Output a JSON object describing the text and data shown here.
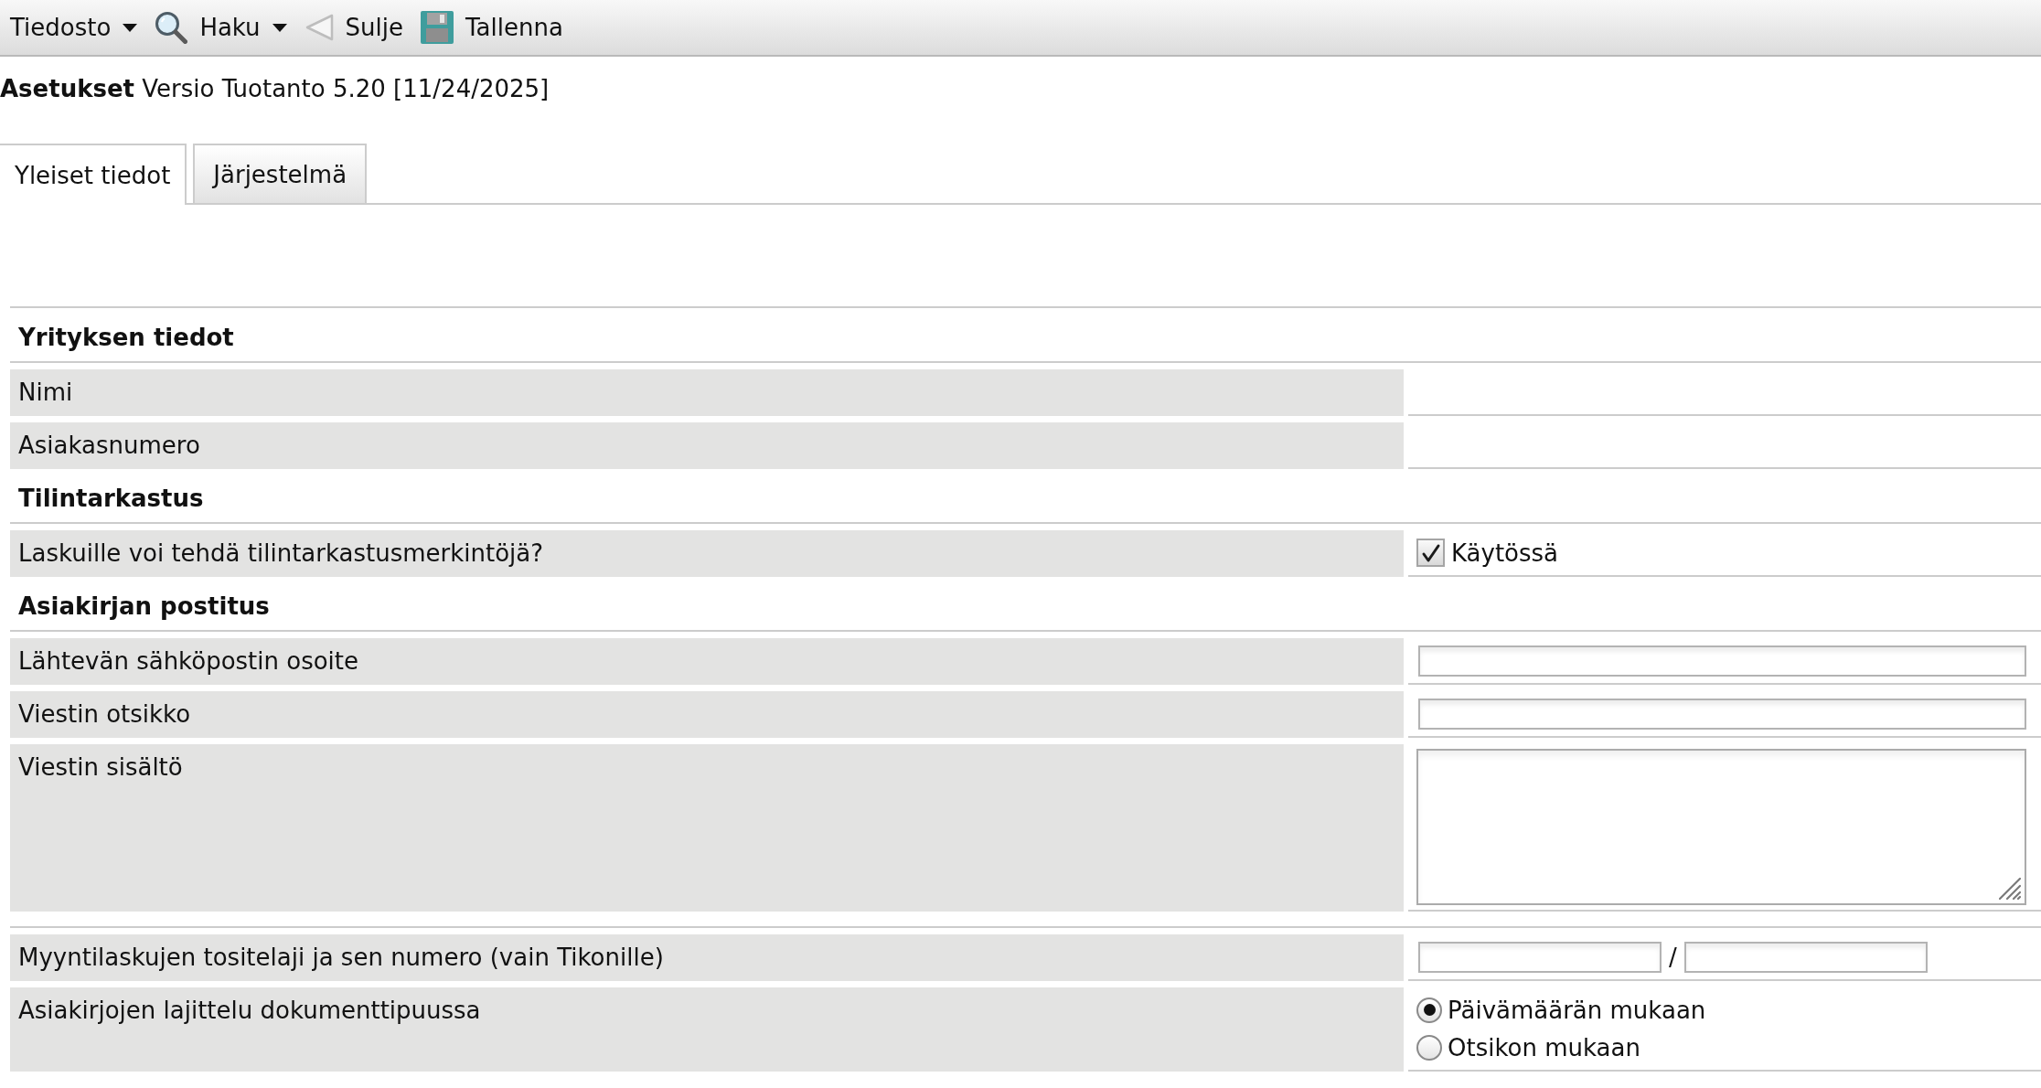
{
  "toolbar": {
    "items": [
      {
        "label": "Tiedosto",
        "kind": "menu"
      },
      {
        "label": "Haku",
        "kind": "menu"
      },
      {
        "label": "Sulje",
        "kind": "button"
      },
      {
        "label": "Tallenna",
        "kind": "button"
      }
    ]
  },
  "page_title": "**Asetukset** Versio Tuotanto 5.20 [11/24/2025]",
  "tabs": [
    {
      "label": "Yleiset tiedot",
      "selected": true
    },
    {
      "label": "Järjestelmä",
      "selected": false
    }
  ],
  "form": {
    "rows": [
      {
        "kind": "section",
        "label": "Yrityksen tiedot"
      },
      {
        "kind": "value",
        "label": "Nimi"
      },
      {
        "kind": "value",
        "label": "Asiakasnumero"
      },
      {
        "kind": "section",
        "label": "Tilintarkastus"
      },
      {
        "kind": "checkbox",
        "label": "Laskuille voi tehdä tilintarkastusmerkintöjä?",
        "option": "Käytössä",
        "checked": true
      },
      {
        "kind": "section",
        "label": "Asiakirjan postitus"
      },
      {
        "kind": "input",
        "label": "Lähtevän sähköpostin osoite"
      },
      {
        "kind": "input",
        "label": "Viestin otsikko"
      },
      {
        "kind": "textarea",
        "label": "Viestin sisältö"
      },
      {
        "kind": "divider"
      },
      {
        "kind": "pair",
        "label": "Myyntilaskujen tositelaji ja sen numero (vain Tikonille)",
        "separator": "/"
      },
      {
        "kind": "radio",
        "label": "Asiakirjojen lajittelu dokumenttipuussa",
        "options": [
          {
            "label": "Päivämäärän mukaan",
            "selected": true
          },
          {
            "label": "Otsikon mukaan",
            "selected": false
          }
        ]
      }
    ]
  }
}
